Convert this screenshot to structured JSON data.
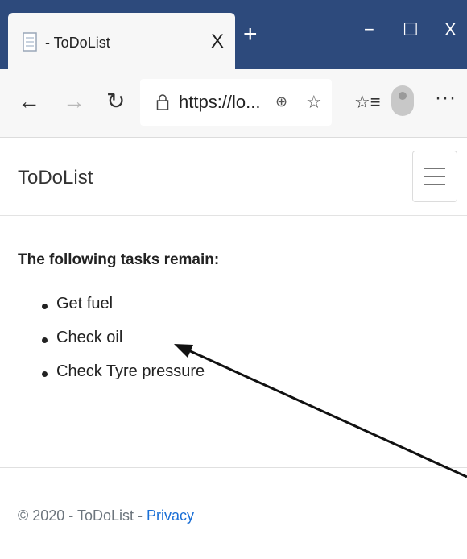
{
  "browser": {
    "tab_title": "- ToDoList",
    "tab_close": "X",
    "new_tab": "+",
    "minimize": "−",
    "maximize": "☐",
    "close": "X",
    "url": "https://lo...",
    "icons": {
      "back": "back-arrow-icon",
      "forward": "forward-arrow-icon",
      "reload": "reload-icon",
      "lock": "lock-icon",
      "zoom": "zoom-icon",
      "favorite": "favorite-star-icon",
      "collections": "collections-icon",
      "profile": "avatar",
      "more": "more-icon"
    }
  },
  "navbar": {
    "brand": "ToDoList"
  },
  "main": {
    "heading": "The following tasks remain:",
    "tasks": [
      "Get fuel",
      "Check oil",
      "Check Tyre pressure"
    ]
  },
  "footer": {
    "text": "© 2020 - ToDoList - ",
    "privacy_link": "Privacy"
  },
  "colors": {
    "titlebar": "#2d4a7c",
    "link": "#1a6fd6"
  }
}
